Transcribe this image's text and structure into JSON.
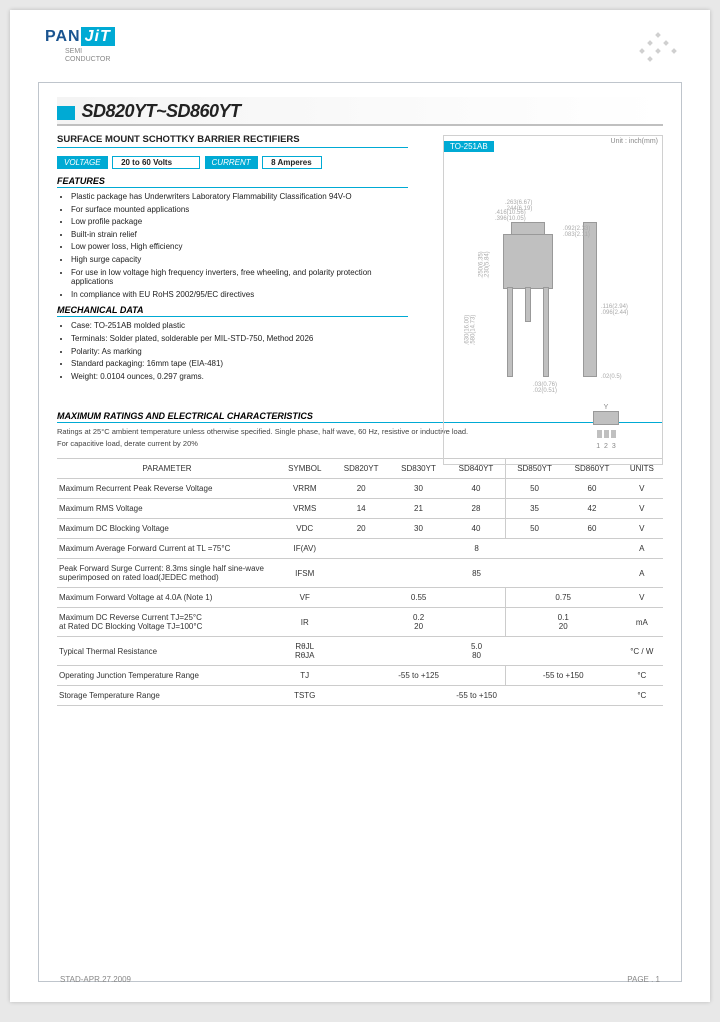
{
  "logo": {
    "part1": "PAN",
    "part2": "JiT",
    "sub1": "SEMI",
    "sub2": "CONDUCTOR"
  },
  "title": "SD820YT~SD860YT",
  "subtitle": "SURFACE MOUNT SCHOTTKY BARRIER RECTIFIERS",
  "voltage": {
    "label": "VOLTAGE",
    "value": "20 to 60  Volts"
  },
  "current": {
    "label": "CURRENT",
    "value": "8 Amperes"
  },
  "features_hdr": "FEATURES",
  "features": [
    "Plastic package has Underwriters Laboratory Flammability Classification 94V-O",
    "For surface mounted applications",
    "Low profile package",
    "Built-in strain relief",
    "Low power loss, High efficiency",
    "High surge capacity",
    "For use in low voltage high frequency inverters, free wheeling, and polarity protection applications",
    "In compliance with EU RoHS 2002/95/EC directives"
  ],
  "mechdata_hdr": "MECHANICAL DATA",
  "mechdata": [
    "Case: TO-251AB molded plastic",
    "Terminals: Solder plated, solderable per MIL-STD-750, Method 2026",
    "Polarity: As marking",
    "Standard packaging: 16mm tape (EIA-481)",
    "Weight: 0.0104 ounces, 0.297 grams."
  ],
  "diagram": {
    "pkg": "TO-251AB",
    "unit": "Unit : inch(mm)"
  },
  "max_hdr": "MAXIMUM RATINGS AND ELECTRICAL CHARACTERISTICS",
  "max_note1": "Ratings at 25°C ambient temperature unless otherwise specified.  Single phase, half wave, 60 Hz, resistive or inductive load.",
  "max_note2": "For capacitive load, derate current by 20%",
  "table": {
    "headers": [
      "PARAMETER",
      "SYMBOL",
      "SD820YT",
      "SD830YT",
      "SD840YT",
      "SD850YT",
      "SD860YT",
      "UNITS"
    ],
    "rows": [
      {
        "p": "Maximum Recurrent Peak Reverse Voltage",
        "s": "VRRM",
        "v": [
          "20",
          "30",
          "40",
          "50",
          "60"
        ],
        "u": "V",
        "span": false
      },
      {
        "p": "Maximum RMS Voltage",
        "s": "VRMS",
        "v": [
          "14",
          "21",
          "28",
          "35",
          "42"
        ],
        "u": "V",
        "span": false
      },
      {
        "p": "Maximum DC Blocking Voltage",
        "s": "VDC",
        "v": [
          "20",
          "30",
          "40",
          "50",
          "60"
        ],
        "u": "V",
        "span": false
      },
      {
        "p": "Maximum Average Forward  Current at TL =75°C",
        "s": "IF(AV)",
        "v": [
          "8"
        ],
        "u": "A",
        "span": true
      },
      {
        "p": "Peak Forward Surge Current: 8.3ms single half sine-wave superimposed on rated load(JEDEC method)",
        "s": "IFSM",
        "v": [
          "85"
        ],
        "u": "A",
        "span": true
      },
      {
        "p": "Maximum Forward Voltage at 4.0A  (Note 1)",
        "s": "VF",
        "v": [
          "0.55",
          "0.75"
        ],
        "u": "V",
        "span": "split"
      },
      {
        "p": "Maximum DC Reverse Current TJ=25°C\nat Rated DC Blocking Voltage  TJ=100°C",
        "s": "IR",
        "v": [
          "0.2\n20",
          "0.1\n20"
        ],
        "u": "mA",
        "span": "split"
      },
      {
        "p": "Typical Thermal Resistance",
        "s": "RθJL\nRθJA",
        "v": [
          "5.0\n80"
        ],
        "u": "°C / W",
        "span": true
      },
      {
        "p": "Operating Junction Temperature Range",
        "s": "TJ",
        "v": [
          "-55 to +125",
          "-55 to +150"
        ],
        "u": "°C",
        "span": "split"
      },
      {
        "p": "Storage Temperature Range",
        "s": "TSTG",
        "v": [
          "-55 to +150"
        ],
        "u": "°C",
        "span": true
      }
    ]
  },
  "footer": {
    "left": "STAD-APR.27.2009",
    "right": "PAGE  . 1"
  }
}
